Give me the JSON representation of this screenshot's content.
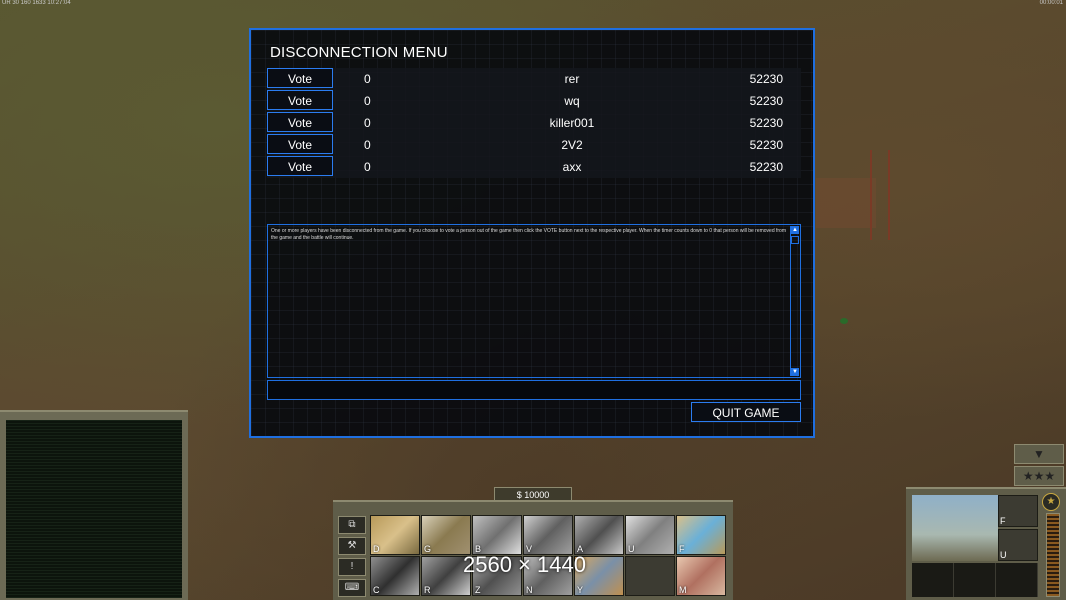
{
  "hud": {
    "top_left": "UR 30 160 1633 10:27:04",
    "top_right": "00:00:01"
  },
  "dialog": {
    "title": "DISCONNECTION MENU",
    "vote_label": "Vote",
    "players": [
      {
        "count": "0",
        "name": "rer",
        "ping": "52230"
      },
      {
        "count": "0",
        "name": "wq",
        "ping": "52230"
      },
      {
        "count": "0",
        "name": "killer001",
        "ping": "52230"
      },
      {
        "count": "0",
        "name": "2V2",
        "ping": "52230"
      },
      {
        "count": "0",
        "name": "axx",
        "ping": "52230"
      }
    ],
    "message": "One or more players have been disconnected from the game. If you choose to vote a person out of the game then click the VOTE button next to the respective player. When the timer counts down to 0 that person will be removed from the game and the battle will continue.",
    "chat_input_value": "",
    "quit_label": "QUIT GAME",
    "scroll_up": "▲",
    "scroll_down": "▼"
  },
  "command_bar": {
    "money": "$ 10000",
    "side_buttons": [
      "⧉",
      "⚒",
      "!",
      "⌨"
    ],
    "build_hotkeys": [
      "D",
      "G",
      "B",
      "V",
      "A",
      "U",
      "F",
      "C",
      "R",
      "Z",
      "N",
      "Y",
      "",
      "M"
    ],
    "resolution_overlay": "2560 × 1440"
  },
  "unit_panel": {
    "toggle_up": "▼",
    "toggle_rank": "★★★",
    "slot_hotkeys": [
      "F",
      "U"
    ],
    "rank_icon": "★"
  },
  "colors": {
    "accent": "#1f6fe0",
    "panel": "#5f5d49",
    "panel_border": "#8d8a70"
  }
}
